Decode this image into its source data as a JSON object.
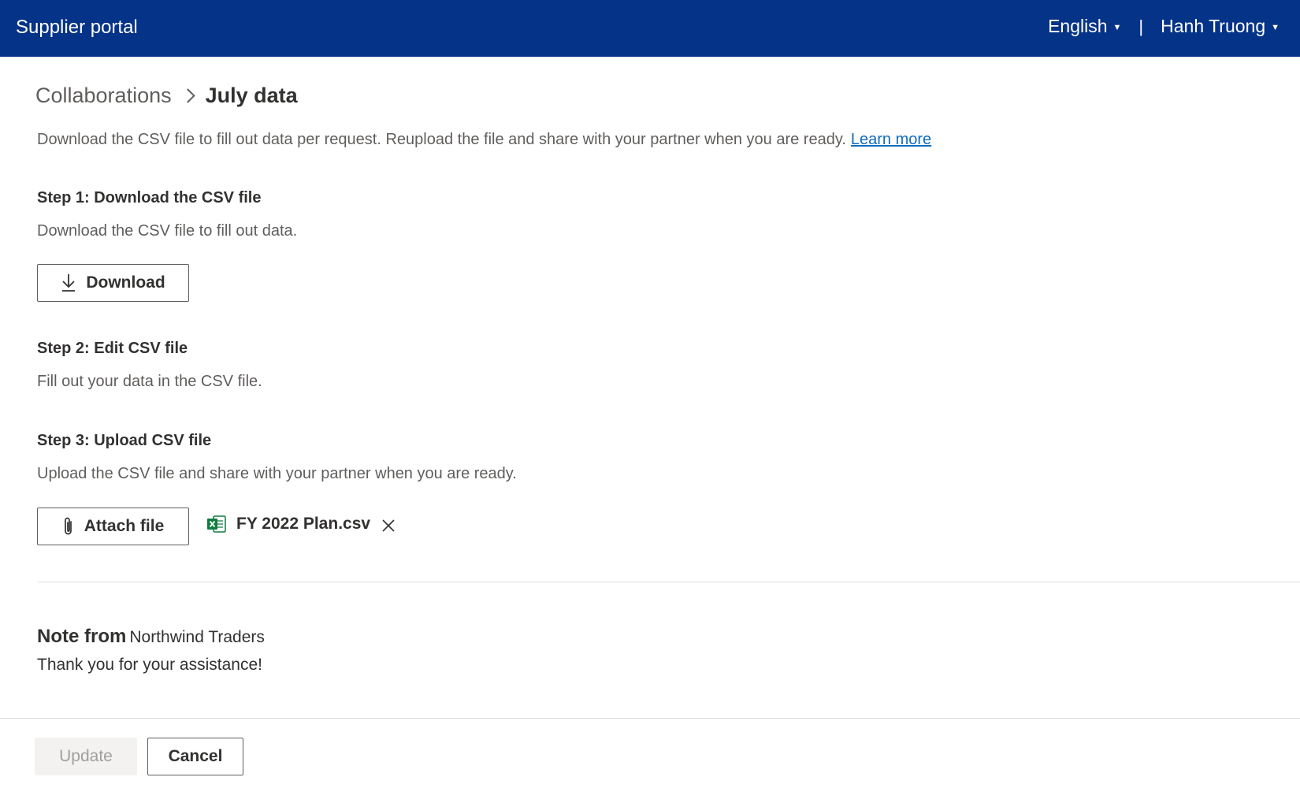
{
  "header": {
    "app_title": "Supplier portal",
    "language": "English",
    "separator": "|",
    "user_name": "Hanh Truong"
  },
  "breadcrumb": {
    "parent": "Collaborations",
    "current": "July data"
  },
  "intro": {
    "text": "Download the CSV file to fill out data per request. Reupload the file and share with your partner when you are ready.",
    "link": "Learn more"
  },
  "steps": [
    {
      "title": "Step 1: Download the CSV file",
      "description": "Download the CSV file to fill out data.",
      "button": "Download"
    },
    {
      "title": "Step 2: Edit CSV file",
      "description": "Fill out your data in the CSV file."
    },
    {
      "title": "Step 3: Upload CSV file",
      "description": "Upload the CSV file and share with your partner when you are ready.",
      "button": "Attach file"
    }
  ],
  "attachment": {
    "file_name": "FY 2022 Plan.csv",
    "icon": "excel-file-icon"
  },
  "note": {
    "label": "Note from",
    "from": "Northwind Traders",
    "message": "Thank you for your assistance!"
  },
  "footer": {
    "update_label": "Update",
    "cancel_label": "Cancel",
    "update_disabled": true
  },
  "colors": {
    "header_bg": "#053387",
    "link": "#0f6cbd",
    "excel_green": "#107c41"
  }
}
